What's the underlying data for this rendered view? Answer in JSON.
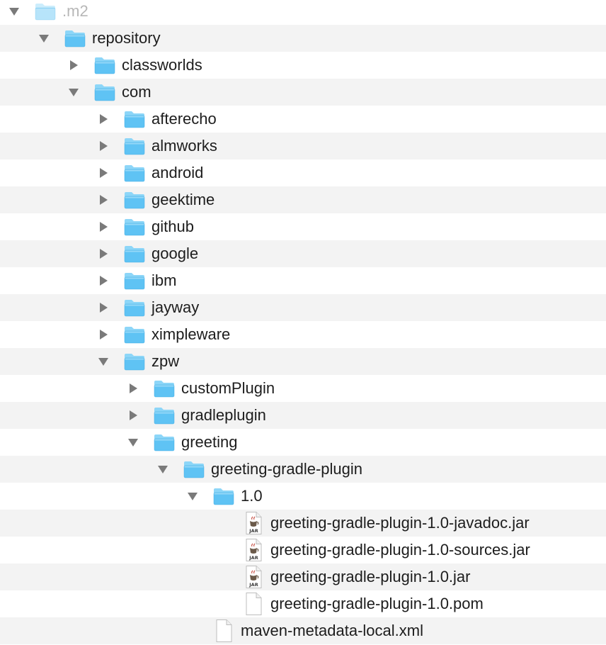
{
  "tree": {
    "rows": [
      {
        "name": ".m2",
        "kind": "folder",
        "depth": 0,
        "expanded": true,
        "dim": true
      },
      {
        "name": "repository",
        "kind": "folder",
        "depth": 1,
        "expanded": true
      },
      {
        "name": "classworlds",
        "kind": "folder",
        "depth": 2,
        "expanded": false
      },
      {
        "name": "com",
        "kind": "folder",
        "depth": 2,
        "expanded": true
      },
      {
        "name": "afterecho",
        "kind": "folder",
        "depth": 3,
        "expanded": false
      },
      {
        "name": "almworks",
        "kind": "folder",
        "depth": 3,
        "expanded": false
      },
      {
        "name": "android",
        "kind": "folder",
        "depth": 3,
        "expanded": false
      },
      {
        "name": "geektime",
        "kind": "folder",
        "depth": 3,
        "expanded": false
      },
      {
        "name": "github",
        "kind": "folder",
        "depth": 3,
        "expanded": false
      },
      {
        "name": "google",
        "kind": "folder",
        "depth": 3,
        "expanded": false
      },
      {
        "name": "ibm",
        "kind": "folder",
        "depth": 3,
        "expanded": false
      },
      {
        "name": "jayway",
        "kind": "folder",
        "depth": 3,
        "expanded": false
      },
      {
        "name": "ximpleware",
        "kind": "folder",
        "depth": 3,
        "expanded": false
      },
      {
        "name": "zpw",
        "kind": "folder",
        "depth": 3,
        "expanded": true
      },
      {
        "name": "customPlugin",
        "kind": "folder",
        "depth": 4,
        "expanded": false
      },
      {
        "name": "gradleplugin",
        "kind": "folder",
        "depth": 4,
        "expanded": false
      },
      {
        "name": "greeting",
        "kind": "folder",
        "depth": 4,
        "expanded": true
      },
      {
        "name": "greeting-gradle-plugin",
        "kind": "folder",
        "depth": 5,
        "expanded": true
      },
      {
        "name": "1.0",
        "kind": "folder",
        "depth": 6,
        "expanded": true
      },
      {
        "name": "greeting-gradle-plugin-1.0-javadoc.jar",
        "kind": "jar",
        "depth": 7
      },
      {
        "name": "greeting-gradle-plugin-1.0-sources.jar",
        "kind": "jar",
        "depth": 7
      },
      {
        "name": "greeting-gradle-plugin-1.0.jar",
        "kind": "jar",
        "depth": 7
      },
      {
        "name": "greeting-gradle-plugin-1.0.pom",
        "kind": "file",
        "depth": 7
      },
      {
        "name": "maven-metadata-local.xml",
        "kind": "file",
        "depth": 6
      }
    ]
  },
  "icons": {
    "folder": "folder-icon",
    "jar": "jar-file-icon",
    "file": "document-icon",
    "expanded": "triangle-down-icon",
    "collapsed": "triangle-right-icon",
    "jar_badge": "JAR"
  },
  "colors": {
    "folder_body": "#5fc3f4",
    "folder_tab": "#8dd6f8",
    "folder_edge": "#3ea9e1",
    "disclosure": "#7a7a7a",
    "stripe": "#f3f3f3",
    "text": "#1d1d1d",
    "text_dim": "#b7b7b7"
  }
}
